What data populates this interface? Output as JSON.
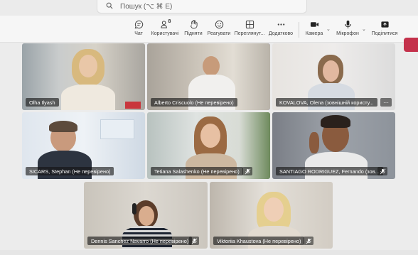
{
  "search": {
    "placeholder": "Пошук (⌥ ⌘ E)"
  },
  "toolbar": {
    "chat": "Чат",
    "people": "Користувачі",
    "people_count": "8",
    "raise": "Підняти",
    "react": "Реагувати",
    "view": "Переглянут...",
    "more": "Додатково",
    "camera": "Камера",
    "mic": "Мікрофон",
    "share": "Поділитися"
  },
  "colors": {
    "accent": "#7f85f5",
    "leave": "#c4314b",
    "muted": "#ffffff"
  },
  "participants": [
    {
      "name": "Olha Ilyash",
      "muted": false,
      "active": false
    },
    {
      "name": "Alberto Criscuolo (Не перевірено)",
      "muted": false,
      "active": true
    },
    {
      "name": "KOVALOVA, Olena (зовнішній користу...",
      "muted": false,
      "active": false,
      "more": "···"
    },
    {
      "name": "SICARS, Stephan (Не перевірено)",
      "muted": false,
      "active": false
    },
    {
      "name": "Tetiana Salashenko (Не перевірено)",
      "muted": true,
      "active": false
    },
    {
      "name": "SANTIAGO RODRIGUEZ, Fernando (зов...",
      "muted": true,
      "active": false
    },
    {
      "name": "Dennis Sanchez Navarro (Не перевірено)",
      "muted": true,
      "active": false
    },
    {
      "name": "Viktoriia Khaustova (Не перевірено)",
      "muted": true,
      "active": false
    }
  ]
}
